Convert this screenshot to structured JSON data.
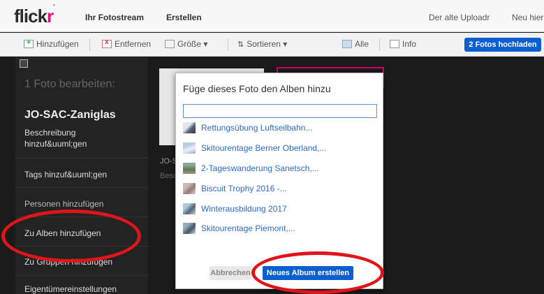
{
  "header": {
    "logo_main": "flick",
    "logo_accent": "r",
    "nav": [
      "Ihr Fotostream",
      "Erstellen"
    ],
    "right_links": [
      "Der alte Uploadr",
      "Neu hier"
    ]
  },
  "toolbar": {
    "add": "Hinzufügen",
    "remove": "Entfernen",
    "size": "Größe ▾",
    "sort": "Sortieren ▾",
    "all": "Alle",
    "info": "Info",
    "upload": "2 Fotos hochladen"
  },
  "sidebar": {
    "edit_title": "1 Foto bearbeiten:",
    "album_name": "JO-SAC-Zaniglas",
    "items": [
      "Beschreibung hinzuf&uuml;gen",
      "Tags hinzuf&uuml;gen",
      "Personen hinzufügen",
      "Zu Alben hinzufügen",
      "Zu Gruppen hinzufügen",
      "Eigentümereinstellungen"
    ]
  },
  "photo": {
    "title_partial": "JO-S",
    "desc_partial": "Besc"
  },
  "dialog": {
    "title": "Füge dieses Foto den Alben hinzu",
    "search_value": "",
    "albums": [
      "Rettungsübung Luftseilbahn...",
      "Skitourentage Berner Oberland,...",
      "2-Tageswanderung Sanetsch,...",
      "Biscuit Trophy 2016 -...",
      "Winterausbildung 2017",
      "Skitourentage Piemont,..."
    ],
    "cancel": "Abbrechen",
    "create": "Neues Album erstellen"
  }
}
